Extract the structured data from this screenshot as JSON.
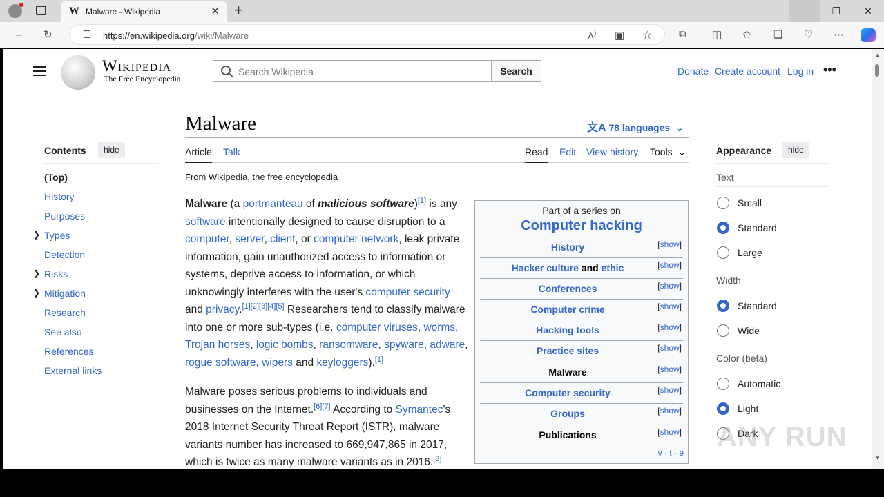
{
  "browser": {
    "tab_title": "Malware - Wikipedia",
    "tab_favicon": "W",
    "new_tab": "+",
    "url_host": "https://en.wikipedia.org",
    "url_path": "/wiki/Malware",
    "window_minimize": "—",
    "window_restore": "❐",
    "window_close": "✕"
  },
  "header": {
    "wordmark": "Wikipedia",
    "tagline": "The Free Encyclopedia",
    "search_placeholder": "Search Wikipedia",
    "search_button": "Search",
    "donate": "Donate",
    "create_account": "Create account",
    "log_in": "Log in"
  },
  "article": {
    "title": "Malware",
    "languages": "78 languages",
    "tab_article": "Article",
    "tab_talk": "Talk",
    "tab_read": "Read",
    "tab_edit": "Edit",
    "tab_history": "View history",
    "tab_tools": "Tools",
    "from": "From Wikipedia, the free encyclopedia",
    "p1": {
      "t1": "Malware",
      "t2": " (a ",
      "l1": "portmanteau",
      "t3": " of ",
      "t4": "malicious software",
      "t5": ")",
      "s1": "[1]",
      "t6": " is any ",
      "l2": "software",
      "t7": " intentionally designed to cause disruption to a ",
      "l3": "computer",
      "t8": ", ",
      "l4": "server",
      "t9": ", ",
      "l5": "client",
      "t10": ", or ",
      "l6": "computer network",
      "t11": ", leak private information, gain unauthorized access to information or systems, deprive access to information, or which unknowingly interferes with the user's ",
      "l7": "computer security",
      "t12": " and ",
      "l8": "privacy",
      "t13": ".",
      "s2": "[1][2][3][4][5]",
      "t14": " Researchers tend to classify malware into one or more sub-types (i.e. ",
      "l9": "computer viruses",
      "t15": ", ",
      "l10": "worms",
      "t16": ", ",
      "l11": "Trojan horses",
      "t17": ", ",
      "l12": "logic bombs",
      "t18": ", ",
      "l13": "ransomware",
      "t19": ", ",
      "l14": "spyware",
      "t20": ", ",
      "l15": "adware",
      "t21": ", ",
      "l16": "rogue software",
      "t22": ", ",
      "l17": "wipers",
      "t23": " and ",
      "l18": "keyloggers",
      "t24": ").",
      "s3": "[1]"
    },
    "p2": {
      "t1": "Malware poses serious problems to individuals and businesses on the Internet.",
      "s1": "[6][7]",
      "t2": " According to ",
      "l1": "Symantec",
      "t3": "'s 2018 Internet Security Threat Report (ISTR), malware variants number has increased to 669,947,865 in 2017, which is twice as many malware variants as in 2016.",
      "s2": "[8]"
    }
  },
  "toc": {
    "heading": "Contents",
    "hide": "hide",
    "items": [
      "(Top)",
      "History",
      "Purposes",
      "Types",
      "Detection",
      "Risks",
      "Mitigation",
      "Research",
      "See also",
      "References",
      "External links"
    ]
  },
  "infobox": {
    "series": "Part of a series on",
    "title": "Computer hacking",
    "rows": [
      {
        "label": "History",
        "linked": true
      },
      {
        "label": "Hacker culture",
        "mid": " and ",
        "label2": "ethic",
        "linked": true
      },
      {
        "label": "Conferences",
        "linked": true
      },
      {
        "label": "Computer crime",
        "linked": true
      },
      {
        "label": "Hacking tools",
        "linked": true
      },
      {
        "label": "Practice sites",
        "linked": true
      },
      {
        "label": "Malware",
        "linked": false
      },
      {
        "label": "Computer security",
        "linked": true
      },
      {
        "label": "Groups",
        "linked": true
      },
      {
        "label": "Publications",
        "linked": false
      }
    ],
    "show": "show",
    "vte": "v · t · e"
  },
  "appearance": {
    "heading": "Appearance",
    "hide": "hide",
    "text_label": "Text",
    "text_options": [
      "Small",
      "Standard",
      "Large"
    ],
    "width_label": "Width",
    "width_options": [
      "Standard",
      "Wide"
    ],
    "color_label": "Color (beta)",
    "color_options": [
      "Automatic",
      "Light",
      "Dark"
    ]
  },
  "watermark": "ANY RUN",
  "colors": {
    "link": "#3366cc",
    "text": "#202122",
    "border": "#a2a9b1"
  }
}
